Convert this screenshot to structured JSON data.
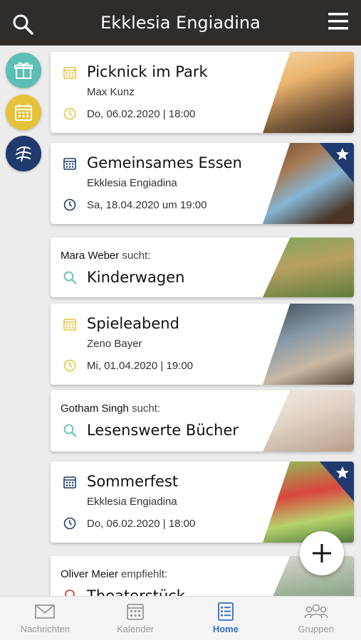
{
  "header": {
    "title": "Ekklesia Engiadina",
    "search_icon": "search-icon",
    "menu_icon": "menu-icon"
  },
  "sidebar": [
    {
      "name": "gift-icon",
      "color": "#5bbfb5"
    },
    {
      "name": "calendar-icon",
      "color": "#e6c23a"
    },
    {
      "name": "church-logo-icon",
      "color": "#1f3a6e"
    }
  ],
  "cards": [
    {
      "type": "event",
      "title": "Picknick im Park",
      "subtitle": "Max Kunz",
      "date": "Do, 06.02.2020 | 18:00",
      "accent": "#e6c23a",
      "starred": false
    },
    {
      "type": "event",
      "title": "Gemeinsames Essen",
      "subtitle": "Ekklesia Engiadina",
      "date": "Sa, 18.04.2020 um 19:00",
      "accent": "#1f3a6e",
      "starred": true
    },
    {
      "type": "search",
      "name": "Mara Weber",
      "verb": "sucht:",
      "title": "Kinderwagen"
    },
    {
      "type": "event",
      "title": "Spieleabend",
      "subtitle": "Zeno Bayer",
      "date": "Mi, 01.04.2020 | 19:00",
      "accent": "#e6c23a",
      "starred": false
    },
    {
      "type": "search",
      "name": "Gotham Singh",
      "verb": "sucht:",
      "title": "Lesenswerte Bücher"
    },
    {
      "type": "event",
      "title": "Sommerfest",
      "subtitle": "Ekklesia Engiadina",
      "date": "Do, 06.02.2020 | 18:00",
      "accent": "#1f3a6e",
      "starred": true
    },
    {
      "type": "recommend",
      "name": "Oliver Meier",
      "verb": "empfiehlt:",
      "title": "Theaterstück"
    }
  ],
  "fab": {
    "icon": "plus-icon"
  },
  "bottom_nav": [
    {
      "label": "Nachrichten",
      "icon": "envelope-icon",
      "active": false
    },
    {
      "label": "Kalender",
      "icon": "calendar-icon",
      "active": false
    },
    {
      "label": "Home",
      "icon": "list-icon",
      "active": true
    },
    {
      "label": "Gruppen",
      "icon": "group-icon",
      "active": false
    }
  ],
  "colors": {
    "header_bg": "#302c2a",
    "accent_yellow": "#e6c23a",
    "accent_navy": "#1f3a6e",
    "accent_teal": "#5bbfb5",
    "active_tab": "#2d6fc9"
  }
}
